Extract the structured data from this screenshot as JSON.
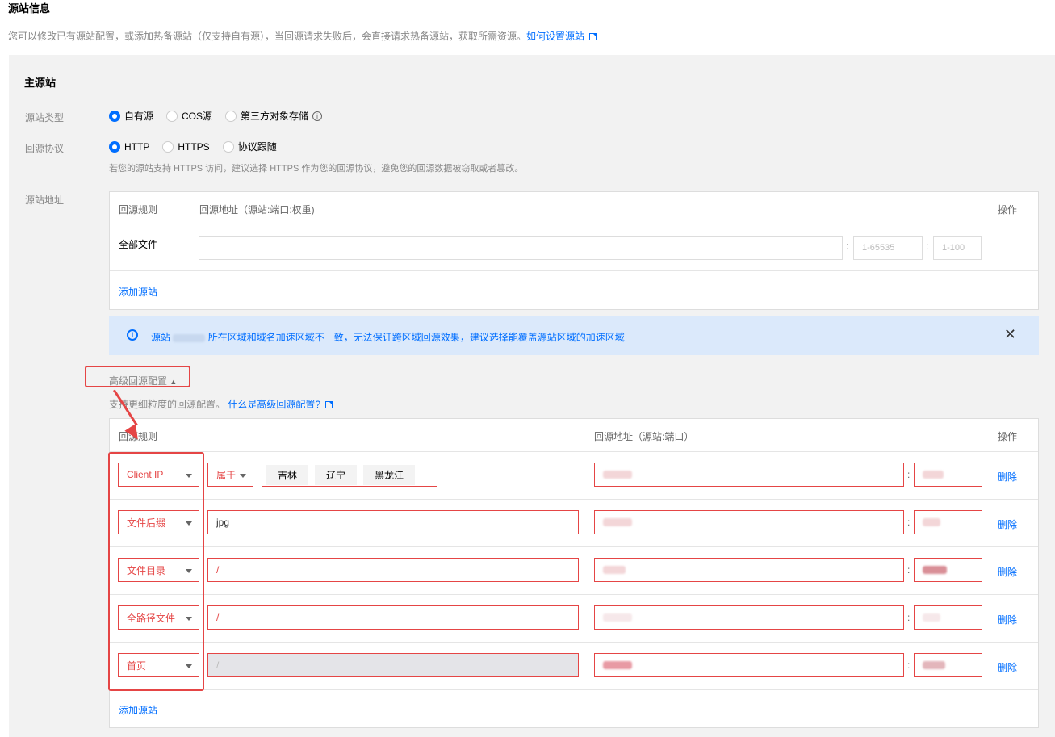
{
  "page": {
    "title": "源站信息",
    "description": "您可以修改已有源站配置，或添加热备源站（仅支持自有源），当回源请求失败后，会直接请求热备源站，获取所需资源。",
    "help_link": "如何设置源站"
  },
  "main_origin": {
    "title": "主源站",
    "origin_type": {
      "label": "源站类型",
      "options": [
        "自有源",
        "COS源",
        "第三方对象存储"
      ],
      "selected": "自有源"
    },
    "protocol": {
      "label": "回源协议",
      "options": [
        "HTTP",
        "HTTPS",
        "协议跟随"
      ],
      "selected": "HTTP",
      "hint": "若您的源站支持 HTTPS 访问，建议选择 HTTPS 作为您的回源协议，避免您的回源数据被窃取或者篡改。"
    },
    "address": {
      "label": "源站地址",
      "columns": [
        "回源规则",
        "回源地址（源站:端口:权重)",
        "操作"
      ],
      "rows": [
        {
          "rule": "全部文件",
          "address": "",
          "port_placeholder": "1-65535",
          "weight_placeholder": "1-100"
        }
      ],
      "add_label": "添加源站"
    }
  },
  "notice": {
    "text_prefix": "源站",
    "text_suffix": "所在区域和域名加速区域不一致，无法保证跨区域回源效果，建议选择能覆盖源站区域的加速区域",
    "close": "✕"
  },
  "advanced": {
    "toggle_label": "高级回源配置",
    "hint": "支持更细粒度的回源配置。",
    "hint_link": "什么是高级回源配置?",
    "columns": [
      "回源规则",
      "回源地址（源站:端口）",
      "操作"
    ],
    "rows": [
      {
        "rule_type": "Client IP",
        "operator": "属于",
        "tags": [
          "吉林",
          "辽宁",
          "黑龙江"
        ],
        "delete": "删除"
      },
      {
        "rule_type": "文件后缀",
        "value": "jpg",
        "delete": "删除"
      },
      {
        "rule_type": "文件目录",
        "value": "/",
        "delete": "删除"
      },
      {
        "rule_type": "全路径文件",
        "value": "/",
        "delete": "删除"
      },
      {
        "rule_type": "首页",
        "value": "/",
        "delete": "删除"
      }
    ],
    "add_label": "添加源站"
  },
  "colors": {
    "accent": "#006eff",
    "highlight": "#e54545",
    "panel_bg": "#f2f2f2",
    "notice_bg": "#dbe9fb"
  }
}
